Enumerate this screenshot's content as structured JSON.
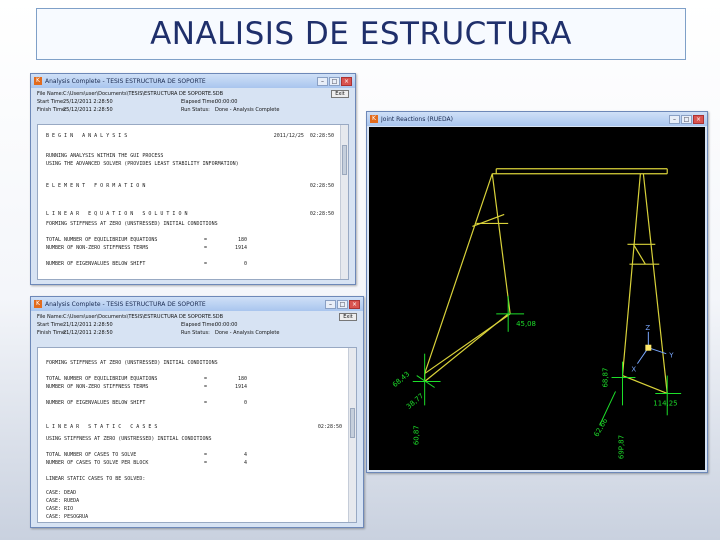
{
  "slide": {
    "title": "ANALISIS DE ESTRUCTURA"
  },
  "window1": {
    "app_icon": "K",
    "title": "Analysis Complete - TESIS ESTRUCTURA DE SOPORTE",
    "controls": [
      "–",
      "□",
      "×"
    ],
    "file_name_label": "File Name:",
    "file_name": "C:\\Users\\user\\Documents\\TESIS\\ESTRUCTURA DE SOPORTE.SDB",
    "start_time_label": "Start Time:",
    "start_time": "25/12/2011 2:28:50",
    "finish_time_label": "Finish Time:",
    "finish_time": "25/12/2011 2:28:50",
    "elapsed_label": "Elapsed Time:",
    "elapsed": "00:00:00",
    "run_status_label": "Run Status:",
    "run_status": "Done - Analysis Complete",
    "exit_label": "Exit",
    "log": {
      "begin": "B E G I N   A N A L Y S I S",
      "begin_time": "2011/12/25  02:28:50",
      "l1": "RUNNING ANALYSIS WITHIN THE GUI PROCESS",
      "l2": "USING THE ADVANCED SOLVER (PROVIDES LEAST STABILITY INFORMATION)",
      "element": "E L E M E N T   F O R M A T I O N",
      "element_time": "02:28:50",
      "linear": "L I N E A R   E Q U A T I O N   S O L U T I O N",
      "linear_time": "02:28:50",
      "l3": "FORMING STIFFNESS AT ZERO (UNSTRESSED) INITIAL CONDITIONS",
      "l4": "TOTAL NUMBER OF EQUILIBRIUM EQUATIONS",
      "l4v": "180",
      "l5": "NUMBER OF NON-ZERO STIFFNESS TERMS",
      "l5v": "1914",
      "l6": "NUMBER OF EIGENVALUES BELOW SHIFT",
      "l6v": "0",
      "eq": "="
    }
  },
  "window2": {
    "app_icon": "K",
    "title": "Analysis Complete - TESIS ESTRUCTURA DE SOPORTE",
    "controls": [
      "–",
      "□",
      "×"
    ],
    "file_name_label": "File Name:",
    "file_name": "C:\\Users\\user\\Documents\\TESIS\\ESTRUCTURA DE SOPORTE.SDB",
    "start_time_label": "Start Time:",
    "start_time": "21/12/2011 2:28:50",
    "finish_time_label": "Finish Time:",
    "finish_time": "21/12/2011 2:28:50",
    "elapsed_label": "Elapsed Time:",
    "elapsed": "00:00:00",
    "run_status_label": "Run Status:",
    "run_status": "Done - Analysis Complete",
    "exit_label": "Exit",
    "log": {
      "l1": "FORMING STIFFNESS AT ZERO (UNSTRESSED) INITIAL CONDITIONS",
      "l2": "TOTAL NUMBER OF EQUILIBRIUM EQUATIONS",
      "l2v": "180",
      "l3": "NUMBER OF NON-ZERO STIFFNESS TERMS",
      "l3v": "1914",
      "l4": "NUMBER OF EIGENVALUES BELOW SHIFT",
      "l4v": "0",
      "static": "L I N E A R   S T A T I C   C A S E S",
      "static_time": "02:28:50",
      "l5": "USING STIFFNESS AT ZERO (UNSTRESSED) INITIAL CONDITIONS",
      "l6": "TOTAL NUMBER OF CASES TO SOLVE",
      "l6v": "4",
      "l7": "NUMBER OF CASES TO SOLVE PER BLOCK",
      "l7v": "4",
      "l8": "LINEAR STATIC CASES TO BE SOLVED:",
      "c1": "CASE: DEAD",
      "c2": "CASE: RUEDA",
      "c3": "CASE: RIO",
      "c4": "CASE: PESOGRUA",
      "eq": "="
    }
  },
  "window3": {
    "app_icon": "K",
    "title": "Joint Reactions  (RUEDA)",
    "controls": [
      "–",
      "□",
      "×"
    ],
    "labels": [
      "68,43",
      "38,77",
      "45,08",
      "60,87",
      "114,25",
      "62,66",
      "69P,87",
      "68,87"
    ],
    "axes": {
      "z": "Z",
      "y": "Y",
      "x": "X"
    },
    "colors": {
      "frame": "#d9d23a",
      "reaction": "#1ddf2a",
      "axis": "#7aa8ff",
      "background": "#000000"
    }
  }
}
